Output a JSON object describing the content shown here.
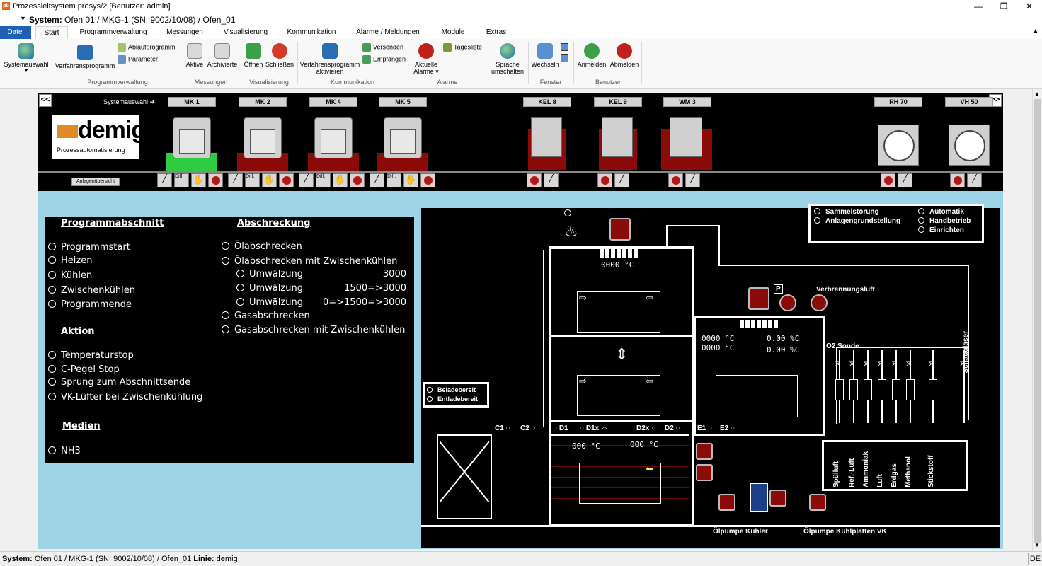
{
  "title_bar": {
    "title": "Prozessleitsystem prosys/2 [Benutzer: admin]",
    "app_icon": "pb"
  },
  "system_bar": {
    "label": "System:",
    "path": "Ofen 01 / MKG-1 (SN: 9002/10/08) / Ofen_01"
  },
  "menu": {
    "tabs": [
      "Datei",
      "Start",
      "Programmverwaltung",
      "Messungen",
      "Visualisierung",
      "Kommunikation",
      "Alarme / Meldungen",
      "Module",
      "Extras"
    ]
  },
  "ribbon": {
    "systemauswahl": "Systemauswahl",
    "verfahrensprogramm": "Verfahrensprogramm",
    "ablaufprogramm": "Ablaufprogramm",
    "parameter": "Parameter",
    "group_programmverwaltung": "Programmverwaltung",
    "aktive": "Aktive",
    "archivierte": "Archivierte",
    "group_messungen": "Messungen",
    "oeffnen": "Öffnen",
    "schliessen": "Schließen",
    "group_visualisierung": "Visualisierung",
    "verfahrensprogramm_aktivieren_1": "Verfahrensprogramm",
    "verfahrensprogramm_aktivieren_2": "aktivieren",
    "versenden": "Versenden",
    "empfangen": "Empfangen",
    "group_kommunikation": "Kommunikation",
    "aktuelle_alarme_1": "Aktuelle",
    "aktuelle_alarme_2": "Alarme",
    "tagesliste": "Tagesliste",
    "group_alarme": "Alarme",
    "sprache_1": "Sprache",
    "sprache_2": "umschalten",
    "wechseln": "Wechseln",
    "group_fenster": "Fenster",
    "anmelden": "Anmelden",
    "abmelden": "Abmelden",
    "group_benutzer": "Benutzer"
  },
  "plant_overview": {
    "systemauswahl_label": "Systemauswahl",
    "units": [
      "MK 1",
      "MK 2",
      "MK 4",
      "MK 5",
      "KEL 8",
      "KEL 9",
      "WM 3",
      "RH 70",
      "VH 50"
    ],
    "logo_text": "demig",
    "logo_sub": "Prozessautomatisierung",
    "anlagen_button": "Anlagenübersicht",
    "diff_label": "Diff."
  },
  "program_panel": {
    "programmabschnitt": {
      "heading": "Programmabschnitt",
      "items": [
        "Programmstart",
        "Heizen",
        "Kühlen",
        "Zwischenkühlen",
        "Programmende"
      ]
    },
    "aktion": {
      "heading": "Aktion",
      "items": [
        "Temperaturstop",
        "C-Pegel Stop",
        "Sprung zum Abschnittsende",
        "VK-Lüfter bei Zwischenkühlung"
      ]
    },
    "medien": {
      "heading": "Medien",
      "items": [
        "NH3"
      ]
    },
    "abschreckung": {
      "heading": "Abschreckung",
      "items": [
        "Ölabschrecken",
        "Ölabschrecken mit Zwischenkühlen"
      ],
      "sub": [
        {
          "label": "Umwälzung",
          "value": "3000"
        },
        {
          "label": "Umwälzung",
          "value": "1500=>3000"
        },
        {
          "label": "Umwälzung",
          "value": "0=>1500=>3000"
        }
      ],
      "items2": [
        "Gasabschrecken",
        "Gasabschrecken mit Zwischenkühlen"
      ]
    }
  },
  "diagram": {
    "status": {
      "sammelstoerung": "Sammelstörung",
      "anlagengrundstellung": "Anlagengrundstellung",
      "automatik": "Automatik",
      "handbetrieb": "Handbetrieb",
      "einrichten": "Einrichten"
    },
    "beladebereit": "Beladebereit",
    "entladebereit": "Entladebereit",
    "temp_top": "0000 °C",
    "temp_right_1": "0000 °C",
    "temp_right_2": "0000 °C",
    "pct_1": "0.00 %C",
    "pct_2": "0.00 %C",
    "oil_temp_1": "000 °C",
    "oil_temp_2": "000 °C",
    "verbrennungsluft": "Verbrennungsluft",
    "schaugaeser": "Schaugläser",
    "o2_sonde": "O2 Sonde",
    "p_label": "P",
    "doors": [
      "C1",
      "C2",
      "D1",
      "D1x",
      "D2x",
      "D2",
      "E1",
      "E2"
    ],
    "gases": [
      "Spülluft",
      "Ref.-Luft",
      "Ammoniak",
      "Luft",
      "Erdgas",
      "Methanol",
      "Stickstoff"
    ],
    "pump_1": "Ölpumpe Kühler",
    "pump_2": "Ölpumpe Kühlplatten VK"
  },
  "status_bar": {
    "system_label": "System:",
    "system_value": "Ofen 01 / MKG-1 (SN: 9002/10/08) / Ofen_01",
    "linie_label": "Linie:",
    "linie_value": "demig",
    "lang": "DE"
  },
  "colors": {
    "accent": "#1f5fb4",
    "furnace_red": "#8b0b0b",
    "active_green": "#2ecc40",
    "panel_bg": "#9fd4e6"
  }
}
